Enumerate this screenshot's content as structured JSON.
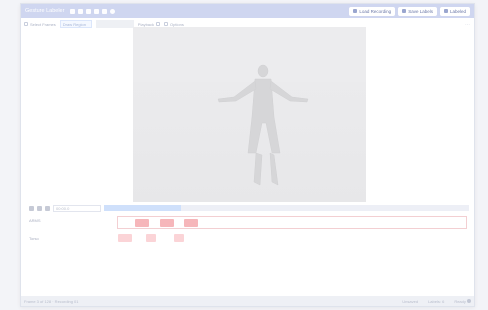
{
  "window": {
    "title": "Gesture Labeler",
    "buttons": [
      {
        "label": "Load Recording",
        "icon": "folder-icon"
      },
      {
        "label": "Save Labels",
        "icon": "save-icon"
      },
      {
        "label": "Labeled",
        "icon": "tag-icon"
      }
    ]
  },
  "toolbar": {
    "items": [
      {
        "label": "Select Frames"
      },
      {
        "label": "Draw Region"
      }
    ],
    "speed_label": "Playback",
    "options_label": "Options"
  },
  "controls": {
    "time": "00:00.0",
    "progress": 0.21
  },
  "timeline": {
    "lanes": [
      {
        "label": "ARMS",
        "color": "#f6b6ba",
        "segments": [
          {
            "start": 0.05,
            "end": 0.09
          },
          {
            "start": 0.12,
            "end": 0.16
          },
          {
            "start": 0.19,
            "end": 0.23
          }
        ]
      },
      {
        "label": "Torso",
        "color": "#fbd4d7",
        "segments": [
          {
            "start": 0.0,
            "end": 0.04
          },
          {
            "start": 0.08,
            "end": 0.11
          },
          {
            "start": 0.16,
            "end": 0.19
          }
        ]
      }
    ]
  },
  "statusbar": {
    "left": "Frame 3 of 128 · Recording 01",
    "right": [
      "Unsaved",
      "Labels: 6",
      "Ready"
    ]
  }
}
